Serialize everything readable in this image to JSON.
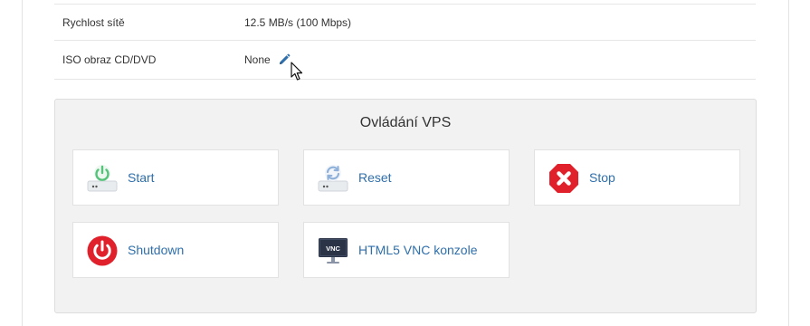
{
  "info": {
    "rows": [
      {
        "label": "Rychlost sítě",
        "value": "12.5 MB/s (100 Mbps)"
      },
      {
        "label": "ISO obraz CD/DVD",
        "value": "None"
      }
    ]
  },
  "control_panel": {
    "title": "Ovládání VPS",
    "buttons": {
      "start": "Start",
      "reset": "Reset",
      "stop": "Stop",
      "shutdown": "Shutdown",
      "vnc": "HTML5 VNC konzole"
    },
    "vnc_icon_text": "VNC"
  },
  "colors": {
    "link": "#2f6fab",
    "stop_red": "#e0212b",
    "shutdown_red": "#e0212b",
    "start_green": "#56c27a",
    "reset_blue": "#8fb0d9"
  },
  "icons": {
    "edit": "pencil-icon",
    "start": "power-drive-green-icon",
    "reset": "refresh-drive-icon",
    "stop": "stop-octagon-icon",
    "shutdown": "power-circle-icon",
    "vnc": "monitor-vnc-icon"
  }
}
